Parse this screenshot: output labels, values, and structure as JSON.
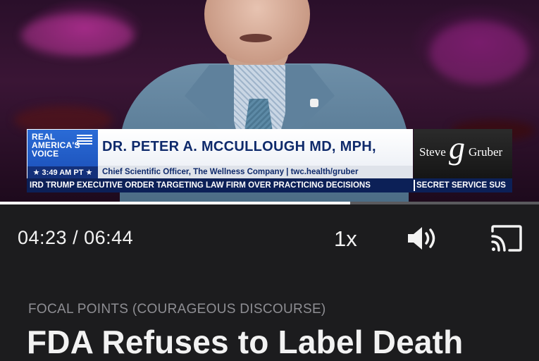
{
  "lower_third": {
    "logo_text": "REAL\nAMERICA'S\nVOICE",
    "time": "★ 3:49 AM PT ★",
    "name": "DR. PETER A. MCCULLOUGH MD, MPH,",
    "subtitle": "Chief Scientific Officer, The Wellness Company | twc.health/gruber",
    "brand_first": "Steve",
    "brand_g": "g",
    "brand_last": "Gruber"
  },
  "ticker": {
    "text_a": "IRD TRUMP EXECUTIVE ORDER TARGETING LAW FIRM OVER PRACTICING DECISIONS",
    "text_b": "SECRET SERVICE SUS"
  },
  "player": {
    "time": "04:23 / 06:44",
    "progress_fraction": 0.65,
    "speed": "1x",
    "volume_icon": "speaker-high-icon",
    "cast_icon": "cast-icon"
  },
  "episode": {
    "category": "FOCAL POINTS (COURAGEOUS DISCOURSE)",
    "title": "FDA Refuses to Label Death"
  },
  "colors": {
    "background": "#1c1c1e",
    "progress_fill": "#ffffff",
    "progress_track": "#5a5a5e",
    "category_text": "#8e8e93",
    "rav_blue": "#1b4fb8",
    "ticker_navy": "#0c2057"
  }
}
